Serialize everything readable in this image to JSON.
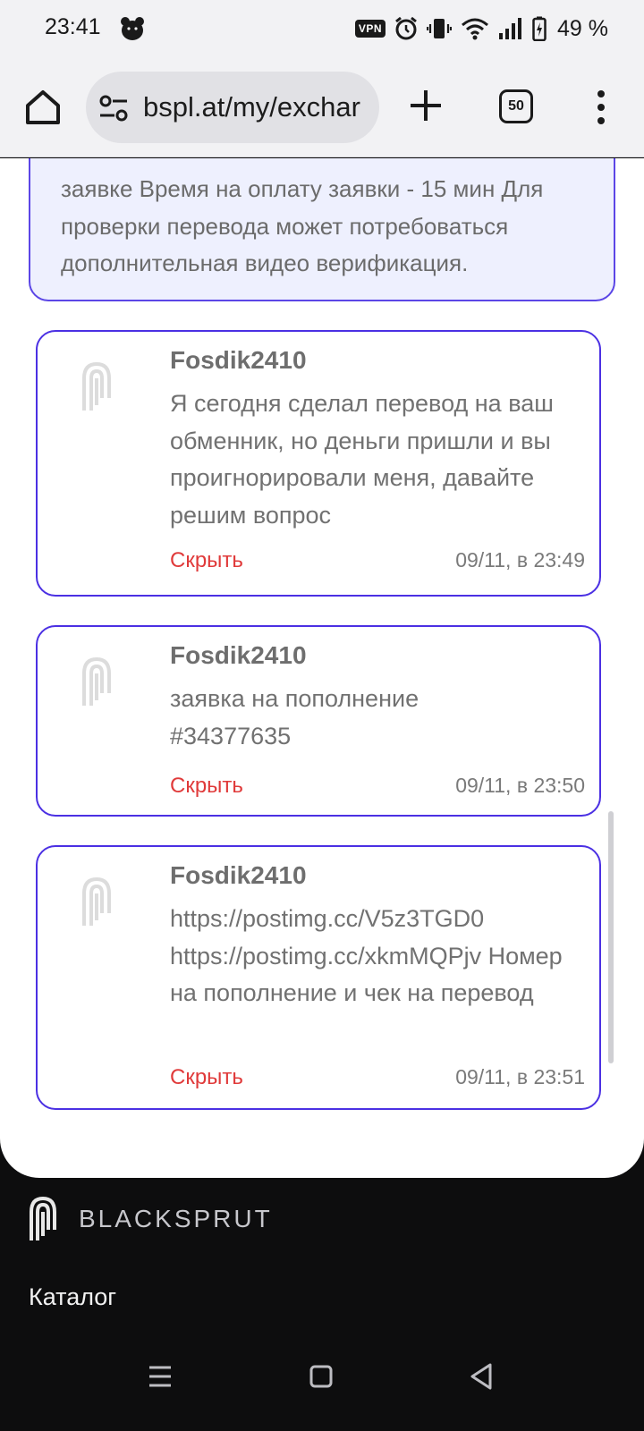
{
  "status_bar": {
    "time": "23:41",
    "vpn_label": "VPN",
    "battery": "49 %",
    "icons": [
      "bear-icon",
      "vpn-icon",
      "alarm-icon",
      "vibrate-icon",
      "wifi-icon",
      "signal-icon",
      "battery-charging-icon"
    ]
  },
  "browser": {
    "url": "bspl.at/my/exchar",
    "tab_count": "50",
    "icons": [
      "home-icon",
      "site-settings-icon",
      "new-tab-icon",
      "tab-switcher-icon",
      "more-menu-icon"
    ]
  },
  "info_box": {
    "partial_line": "",
    "text": "заявке Время на оплату заявки - 15 мин Для проверки перевода может потребоваться дополнительная видео верификация."
  },
  "messages": [
    {
      "author": "Fosdik2410",
      "text": "Я сегодня сделал перевод на ваш обменник, но деньги пришли и вы проигнорировали меня, давайте решим вопрос",
      "hide_label": "Скрыть",
      "time": "09/11, в 23:49"
    },
    {
      "author": "Fosdik2410",
      "text": "заявка на пополнение #34377635",
      "hide_label": "Скрыть",
      "time": "09/11, в 23:50"
    },
    {
      "author": "Fosdik2410",
      "text": "https://postimg.cc/V5z3TGD0 https://postimg.cc/xkmMQPjv Номер на пополнение и чек на перевод",
      "hide_label": "Скрыть",
      "time": "09/11, в 23:51"
    }
  ],
  "footer": {
    "brand": "BLACKSPRUT",
    "catalog_title": "Каталог"
  },
  "nav": {
    "icons": [
      "recents-icon",
      "home-square-icon",
      "back-icon"
    ]
  },
  "colors": {
    "accent_border": "#4b30e3",
    "info_bg": "#eef0fe",
    "hide_red": "#e03a3a",
    "footer_bg": "#0d0d0e"
  }
}
